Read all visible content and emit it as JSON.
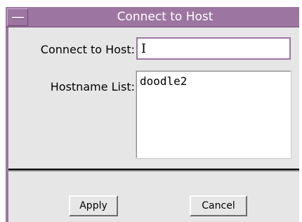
{
  "window": {
    "title": "Connect to Host"
  },
  "form": {
    "host_label": "Connect to Host:",
    "host_value": "",
    "hostname_list_label": "Hostname List:",
    "hostnames": [
      "doodle2"
    ]
  },
  "buttons": {
    "apply_label": "Apply",
    "cancel_label": "Cancel"
  },
  "colors": {
    "titlebar": "#9c76a1",
    "dialog_background": "#e6e6e6",
    "focus_border": "#9c76a1"
  }
}
